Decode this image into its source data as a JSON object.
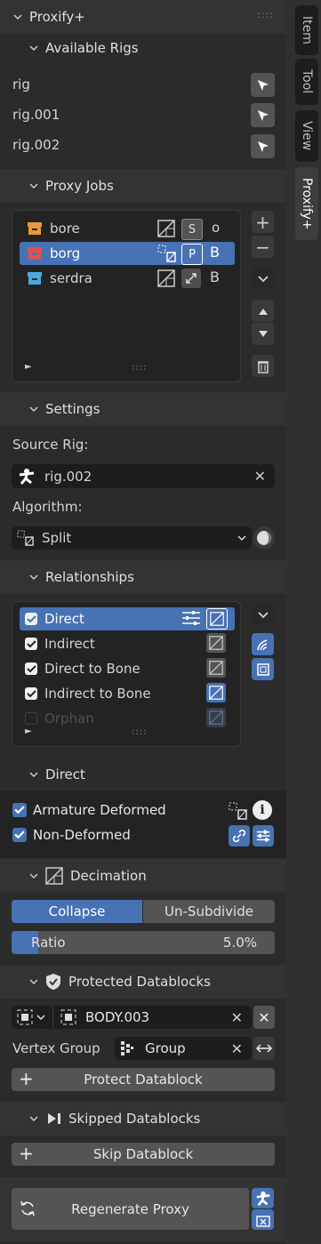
{
  "panel_title": "Proxify+",
  "tabs": [
    "Item",
    "Tool",
    "View",
    "Proxify+"
  ],
  "available_rigs": {
    "title": "Available Rigs",
    "items": [
      "rig",
      "rig.001",
      "rig.002"
    ]
  },
  "proxy_jobs": {
    "title": "Proxy Jobs",
    "items": [
      {
        "name": "bore",
        "badge": "S",
        "flag": "o",
        "color": "#e89a3c"
      },
      {
        "name": "borg",
        "badge": "P",
        "flag": "B",
        "color": "#e05050"
      },
      {
        "name": "serdra",
        "badge": "",
        "flag": "B",
        "color": "#4aa8e0"
      }
    ],
    "grip": "::::"
  },
  "settings": {
    "title": "Settings",
    "source_rig_label": "Source Rig:",
    "source_rig_value": "rig.002",
    "algorithm_label": "Algorithm:",
    "algorithm_value": "Split"
  },
  "relationships": {
    "title": "Relationships",
    "items": [
      {
        "name": "Direct",
        "checked": true
      },
      {
        "name": "Indirect",
        "checked": true
      },
      {
        "name": "Direct to Bone",
        "checked": true
      },
      {
        "name": "Indirect to Bone",
        "checked": true
      },
      {
        "name": "Orphan",
        "checked": false
      }
    ],
    "grip": "::::"
  },
  "direct": {
    "title": "Direct",
    "armature_deformed": "Armature Deformed",
    "non_deformed": "Non-Deformed"
  },
  "decimation": {
    "title": "Decimation",
    "mode_collapse": "Collapse",
    "mode_unsubdivide": "Un-Subdivide",
    "ratio_label": "Ratio",
    "ratio_value": "5.0%",
    "ratio_fraction": 0.05
  },
  "protected": {
    "title": "Protected Datablocks",
    "datablock": "BODY.003",
    "vertex_group_label": "Vertex Group",
    "vertex_group_value": "Group",
    "add_label": "Protect Datablock"
  },
  "skipped": {
    "title": "Skipped Datablocks",
    "add_label": "Skip Datablock"
  },
  "regenerate_label": "Regenerate Proxy",
  "colors": {
    "accent": "#4772b3",
    "panel": "#2b2b2b",
    "field": "#1d1d1d"
  }
}
